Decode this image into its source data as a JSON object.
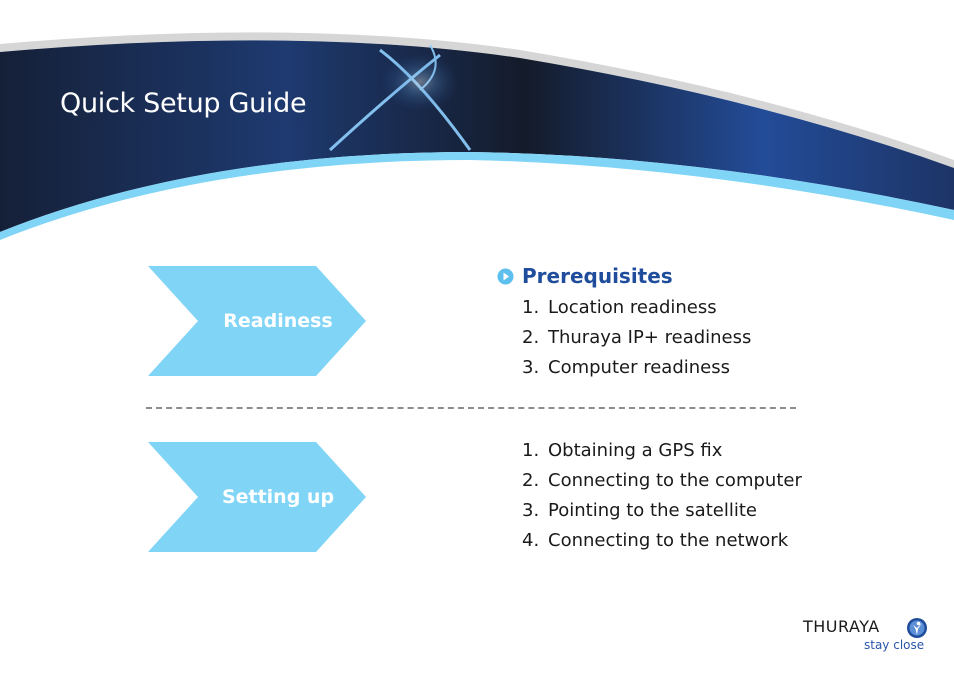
{
  "header": {
    "title": "Quick Setup Guide"
  },
  "phases": [
    {
      "label": "Readiness",
      "heading": "Prerequisites",
      "steps": [
        {
          "num": "1.",
          "text": "Location readiness"
        },
        {
          "num": "2.",
          "text": "Thuraya IP+ readiness"
        },
        {
          "num": "3.",
          "text": "Computer readiness"
        }
      ]
    },
    {
      "label": "Setting up",
      "steps": [
        {
          "num": "1.",
          "text": "Obtaining a GPS fix"
        },
        {
          "num": "2.",
          "text": "Connecting to the computer"
        },
        {
          "num": "3.",
          "text": "Pointing to the satellite"
        },
        {
          "num": "4.",
          "text": "Connecting to the network"
        }
      ]
    }
  ],
  "logo": {
    "brand": "THURAYA",
    "tagline": "stay close",
    "icon": "thuraya-figure-icon"
  },
  "colors": {
    "banner_dark": "#13203a",
    "banner_blue": "#234c98",
    "accent_light": "#80d4f6",
    "heading": "#1f4d9c",
    "divider": "#8c8c8c",
    "banner_edge": "#d6d6d6"
  }
}
